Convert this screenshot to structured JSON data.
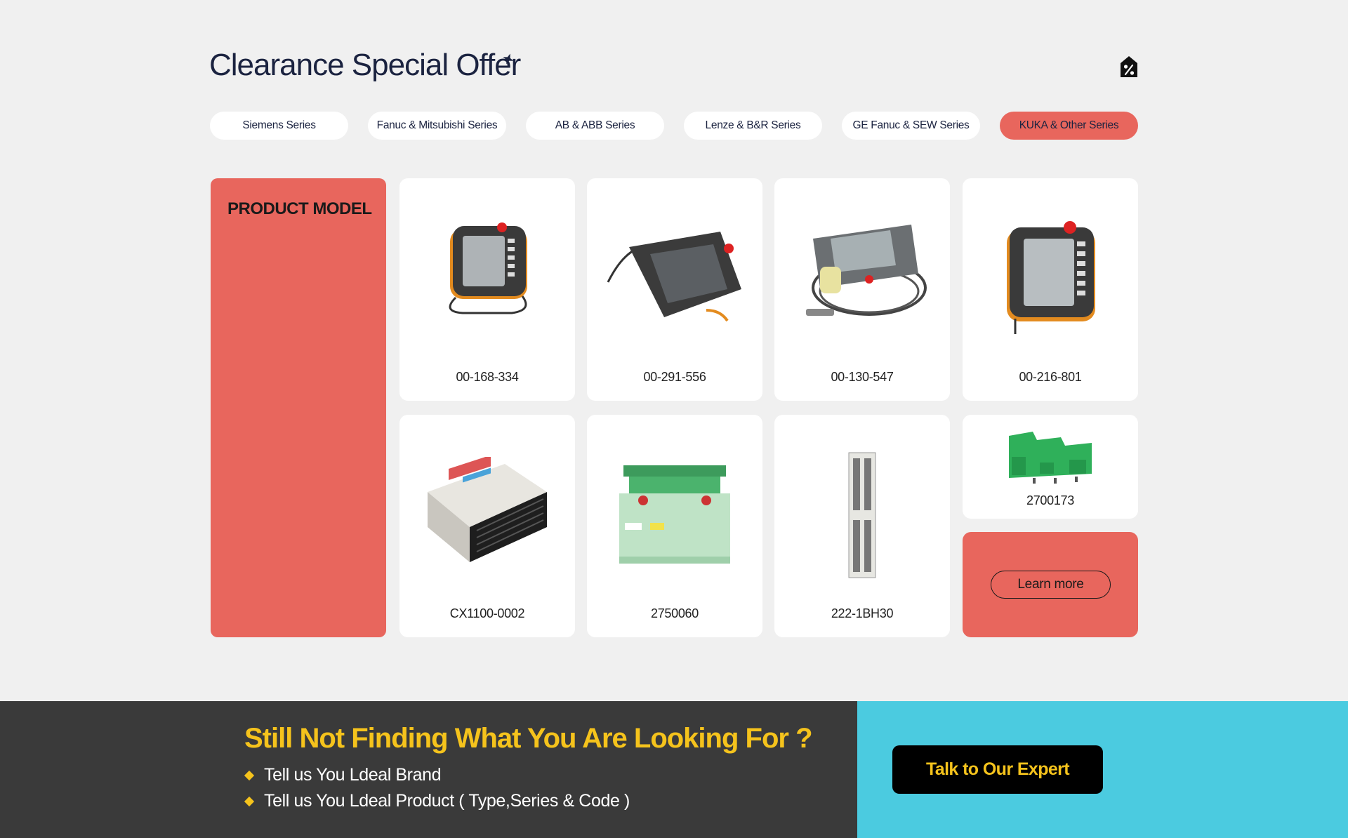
{
  "header": {
    "title": "Clearance Special Offer",
    "spark_icon": "sparkle-icon",
    "offer_icon": "discount-tag-icon"
  },
  "tabs": [
    {
      "label": "Siemens Series",
      "active": false
    },
    {
      "label": "Fanuc & Mitsubishi Series",
      "active": false
    },
    {
      "label": "AB & ABB Series",
      "active": false
    },
    {
      "label": "Lenze & B&R Series",
      "active": false
    },
    {
      "label": "GE Fanuc & SEW Series",
      "active": false
    },
    {
      "label": "KUKA & Other Series",
      "active": true
    }
  ],
  "side_panel": {
    "title": "PRODUCT MODEL"
  },
  "products": [
    {
      "code": "00-168-334",
      "image": "teach-pendant-orange"
    },
    {
      "code": "00-291-556",
      "image": "teach-pendant-dark"
    },
    {
      "code": "00-130-547",
      "image": "teach-pendant-cable"
    },
    {
      "code": "00-216-801",
      "image": "teach-pendant-orange-large"
    },
    {
      "code": "CX1100-0002",
      "image": "plc-module-white"
    },
    {
      "code": "2750060",
      "image": "interbus-module-green"
    },
    {
      "code": "222-1BH30",
      "image": "io-module-slim"
    },
    {
      "code": "2700173",
      "image": "terminal-block-green"
    }
  ],
  "cta": {
    "learn_more": "Learn more"
  },
  "footer": {
    "headline": "Still Not Finding What You Are Looking For ?",
    "bullets": [
      "Tell us You Ldeal Brand",
      "Tell us You Ldeal Product ( Type,Series & Code )"
    ],
    "button": "Talk to Our Expert"
  },
  "colors": {
    "accent": "#e8665d",
    "footer_dark": "#3a3a3a",
    "footer_cyan": "#4bcbe0",
    "highlight_yellow": "#f5c31c"
  }
}
